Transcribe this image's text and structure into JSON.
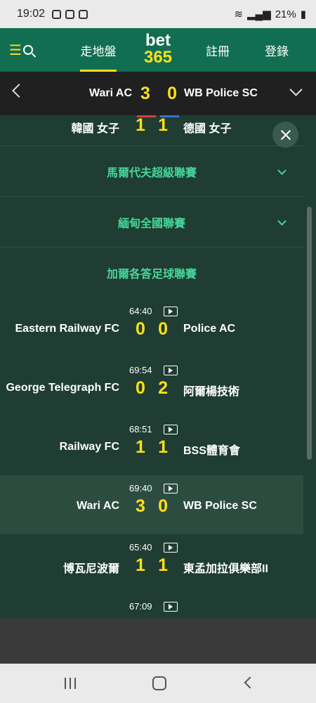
{
  "status_bar": {
    "time": "19:02",
    "battery": "21%"
  },
  "nav": {
    "in_play": "走地盤",
    "logo_top": "bet",
    "logo_bottom": "365",
    "register": "註冊",
    "login": "登錄"
  },
  "match_header": {
    "home": "Wari AC",
    "home_score": "3",
    "away_score": "0",
    "away": "WB Police SC"
  },
  "peek_match": {
    "home": "韓國 女子",
    "home_score": "1",
    "away_score": "1",
    "away": "德國 女子"
  },
  "leagues": [
    {
      "name": "馬爾代夫超級聯賽"
    },
    {
      "name": "緬甸全國聯賽"
    },
    {
      "name": "加爾各答足球聯賽"
    }
  ],
  "matches": [
    {
      "clock": "64:40",
      "home": "Eastern Railway FC",
      "home_score": "0",
      "away_score": "0",
      "away": "Police AC"
    },
    {
      "clock": "69:54",
      "home": "George Telegraph FC",
      "home_score": "0",
      "away_score": "2",
      "away": "阿爾楊技術"
    },
    {
      "clock": "68:51",
      "home": "Railway FC",
      "home_score": "1",
      "away_score": "1",
      "away": "BSS體育會"
    },
    {
      "clock": "69:40",
      "home": "Wari AC",
      "home_score": "3",
      "away_score": "0",
      "away": "WB Police SC"
    },
    {
      "clock": "65:40",
      "home": "博瓦尼波爾",
      "home_score": "1",
      "away_score": "1",
      "away": "東孟加拉俱樂部II"
    },
    {
      "clock": "67:09",
      "home": "",
      "home_score": "",
      "away_score": "",
      "away": ""
    }
  ],
  "colors": {
    "brand_green": "#126e51",
    "accent_yellow": "#ffdf1b",
    "league_green": "#45d69a"
  },
  "icons": [
    "menu-icon",
    "search-icon",
    "back-arrow-icon",
    "chevron-down-icon",
    "close-icon",
    "tv-icon"
  ]
}
